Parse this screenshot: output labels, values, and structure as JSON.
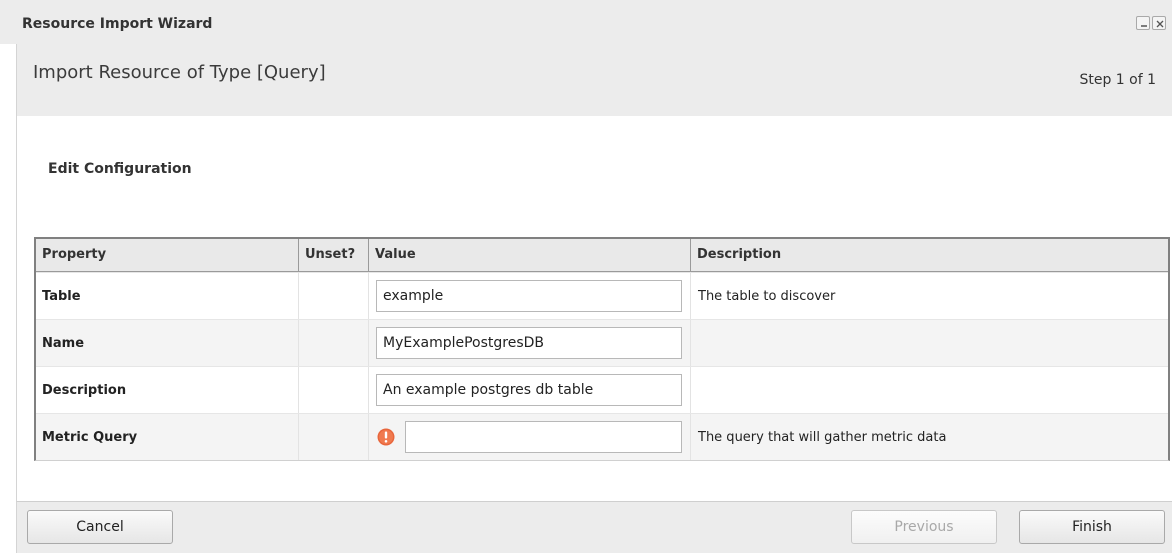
{
  "window": {
    "title": "Resource Import Wizard"
  },
  "header": {
    "title": "Import Resource of Type [Query]",
    "step": "Step 1 of 1"
  },
  "section": {
    "title": "Edit Configuration"
  },
  "grid": {
    "columns": [
      "Property",
      "Unset?",
      "Value",
      "Description"
    ],
    "rows": [
      {
        "property": "Table",
        "value": "example",
        "description": "The table to discover",
        "error": false
      },
      {
        "property": "Name",
        "value": "MyExamplePostgresDB",
        "description": "",
        "error": false
      },
      {
        "property": "Description",
        "value": "An example postgres db table",
        "description": "",
        "error": false
      },
      {
        "property": "Metric Query",
        "value": "",
        "description": "The query that will gather metric data",
        "error": true
      }
    ]
  },
  "footer": {
    "cancel_label": "Cancel",
    "previous_label": "Previous",
    "finish_label": "Finish"
  },
  "icons": {
    "minimize": "minimize-icon",
    "close": "close-icon",
    "error": "error-icon"
  },
  "colors": {
    "error_icon": "#e8663c",
    "header_bg": "#ececec"
  }
}
